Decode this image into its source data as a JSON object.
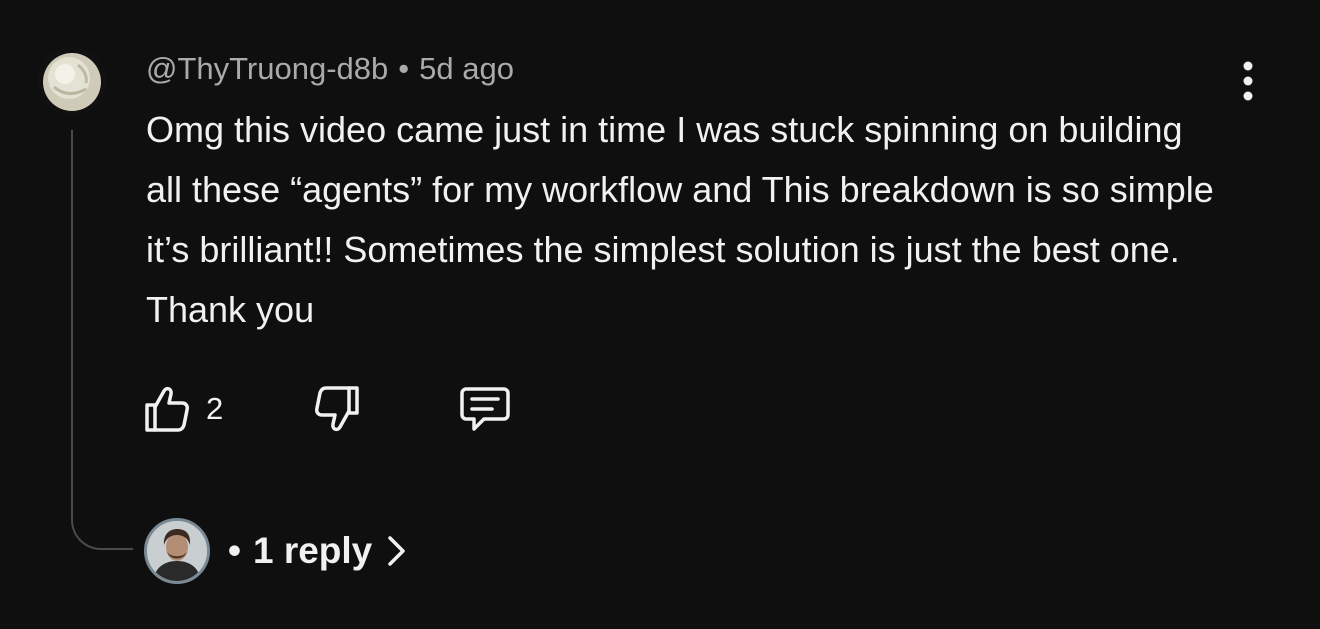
{
  "comment": {
    "author": "@ThyTruong-d8b",
    "separator": "•",
    "time": "5d ago",
    "text": "Omg this video came just in time I was stuck spinning on building all these “agents” for my workflow and This breakdown is so simple it’s brilliant!!  Sometimes the simplest solution is just the best one. Thank you",
    "likes": "2"
  },
  "actions": {
    "like_icon": "thumbs-up-icon",
    "dislike_icon": "thumbs-down-icon",
    "reply_icon": "comment-icon",
    "menu_icon": "more-vertical-icon"
  },
  "replies": {
    "separator": "•",
    "label": "1 reply",
    "chevron_icon": "chevron-right-icon"
  },
  "colors": {
    "background": "#0f0f0f",
    "primary_text": "#f1f1f1",
    "secondary_text": "#aaaaaa",
    "thread_line": "#4a4a4a"
  }
}
